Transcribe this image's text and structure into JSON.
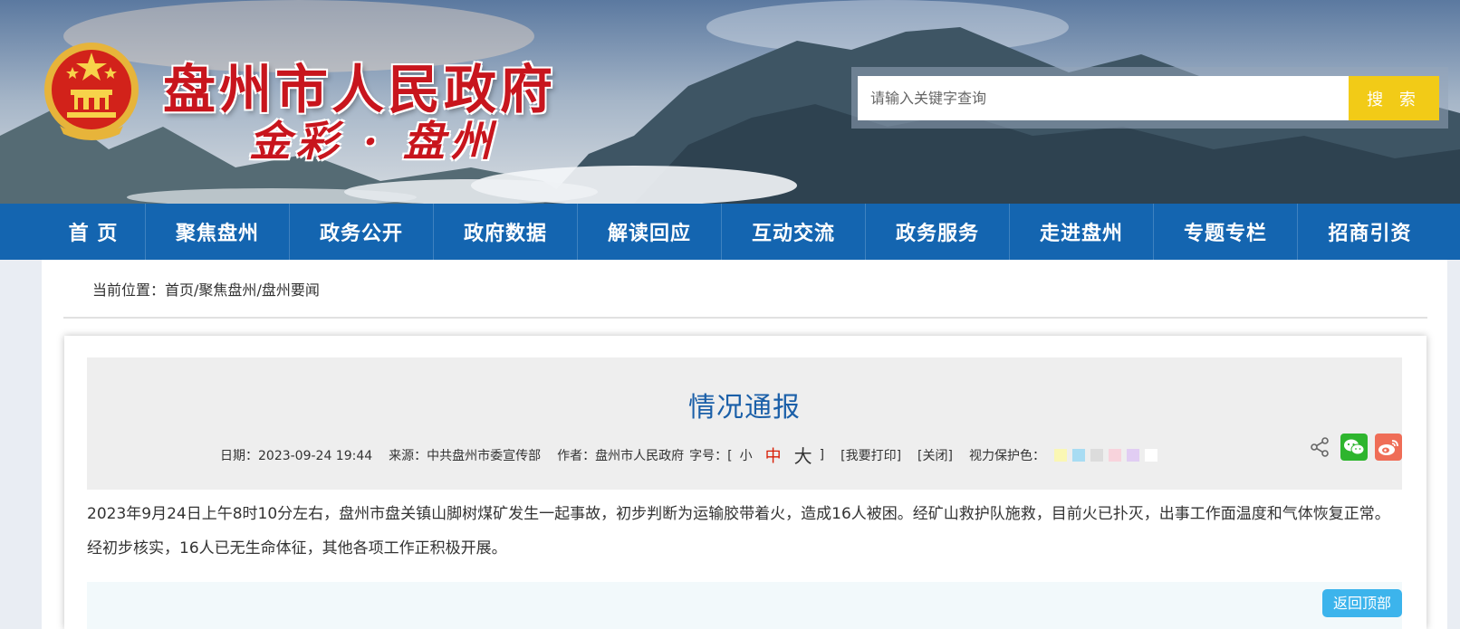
{
  "header": {
    "site_title": "盘州市人民政府",
    "slogan": "金彩 · 盘州",
    "emblem_icon": "national-emblem-icon",
    "search": {
      "placeholder": "请输入关键字查询",
      "button_label": "搜 索"
    }
  },
  "nav": {
    "items": [
      {
        "label": "首 页"
      },
      {
        "label": "聚焦盘州"
      },
      {
        "label": "政务公开"
      },
      {
        "label": "政府数据"
      },
      {
        "label": "解读回应"
      },
      {
        "label": "互动交流"
      },
      {
        "label": "政务服务"
      },
      {
        "label": "走进盘州"
      },
      {
        "label": "专题专栏"
      },
      {
        "label": "招商引资"
      }
    ]
  },
  "breadcrumb": {
    "prefix": "当前位置：",
    "items": [
      "首页",
      "聚焦盘州",
      "盘州要闻"
    ],
    "separator": "/"
  },
  "article": {
    "title": "情况通报",
    "meta": {
      "date": "日期：2023-09-24 19:44",
      "source": "来源：中共盘州市委宣传部",
      "author": "作者：盘州市人民政府",
      "font_size_label": "字号：[",
      "font_small": "小",
      "font_medium": "中",
      "font_large": "大",
      "font_close": "]",
      "print": "[我要打印]",
      "close": "[关闭]",
      "eye_color_label": "视力保护色："
    },
    "eye_colors": [
      "#faf7b4",
      "#a8dcf3",
      "#dcdcdc",
      "#f8d3dc",
      "#e1cdf3",
      "#ffffff"
    ],
    "body": "2023年9月24日上午8时10分左右，盘州市盘关镇山脚树煤矿发生一起事故，初步判断为运输胶带着火，造成16人被困。经矿山救护队施救，目前火已扑灭，出事工作面温度和气体恢复正常。经初步核实，16人已无生命体征，其他各项工作正积极开展。",
    "back_to_top": "返回顶部",
    "share_icons": [
      "share-icon",
      "wechat-icon",
      "weibo-icon"
    ]
  },
  "colors": {
    "nav_bg": "#1465b0",
    "title_blue": "#1a5fa8",
    "search_button": "#f2cb17",
    "back_top": "#3cb4ec",
    "emphasis_red": "#d81e06"
  }
}
